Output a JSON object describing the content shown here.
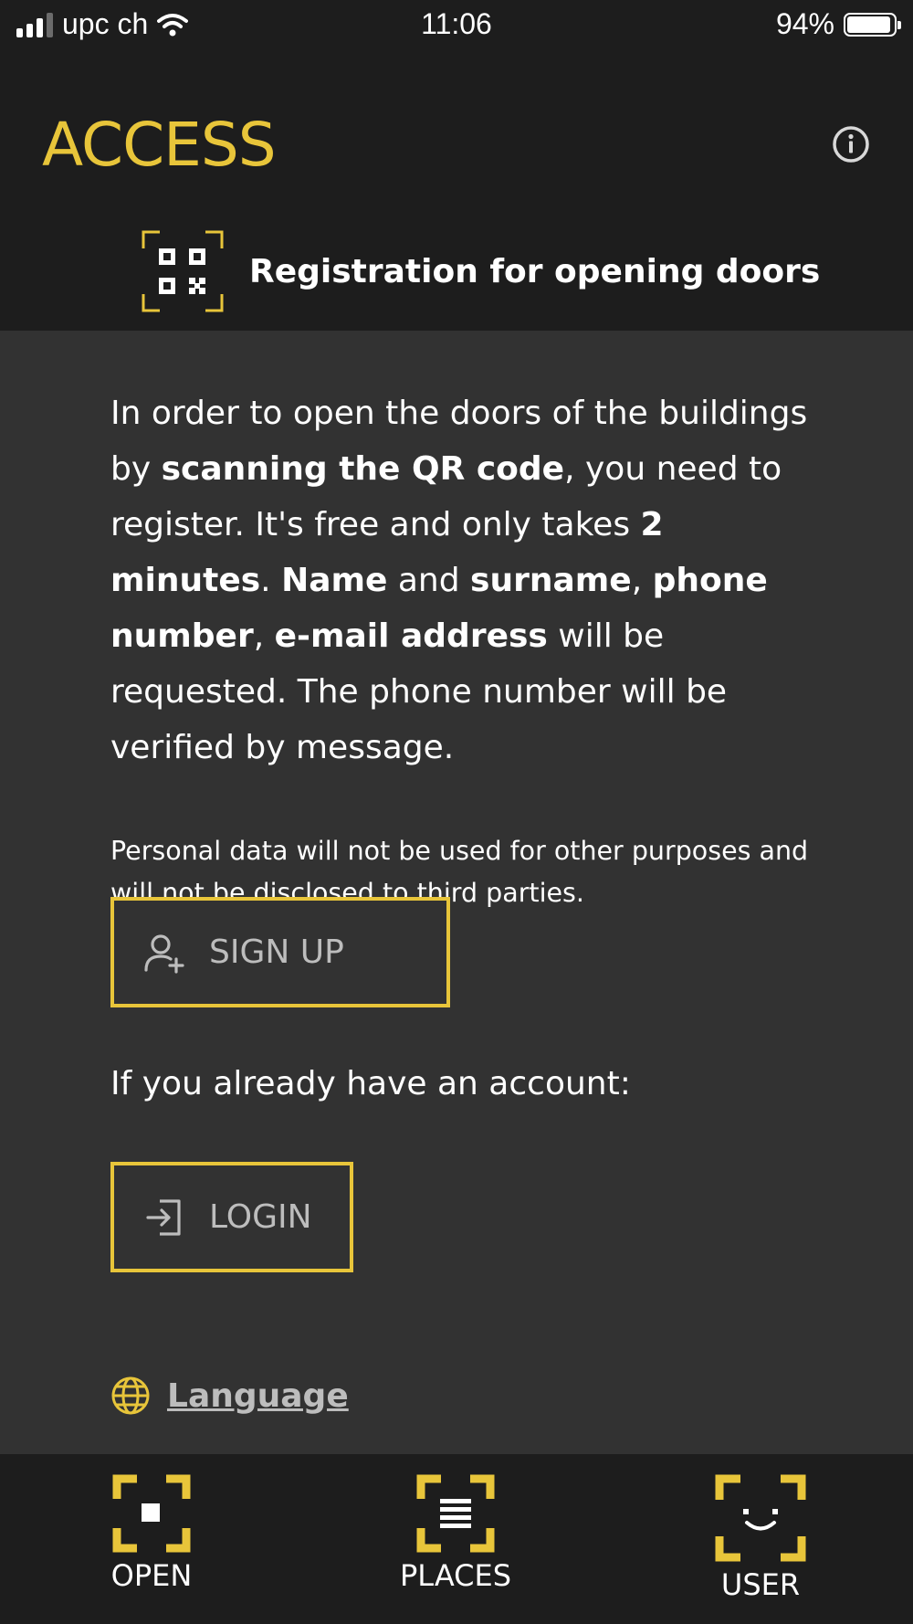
{
  "status_bar": {
    "carrier": "upc ch",
    "time": "11:06",
    "battery_percent": "94%",
    "battery_level": 0.94,
    "signal_bars": 3
  },
  "header": {
    "app_title": "ACCESS",
    "section_title": "Registration for opening doors",
    "accent_color": "#e8c53a"
  },
  "intro": {
    "segments": [
      {
        "text": "In order to open the doors of the buildings by ",
        "bold": false
      },
      {
        "text": "scanning the QR code",
        "bold": true
      },
      {
        "text": ", you need to register. It's free and only takes ",
        "bold": false
      },
      {
        "text": "2 minutes",
        "bold": true
      },
      {
        "text": ". ",
        "bold": false
      },
      {
        "text": "Name",
        "bold": true
      },
      {
        "text": " and ",
        "bold": false
      },
      {
        "text": "surname",
        "bold": true
      },
      {
        "text": ", ",
        "bold": false
      },
      {
        "text": "phone number",
        "bold": true
      },
      {
        "text": ", ",
        "bold": false
      },
      {
        "text": "e-mail address",
        "bold": true
      },
      {
        "text": " will be requested. The phone number will be verified by message.",
        "bold": false
      }
    ]
  },
  "privacy_note": "Personal data will not be used for other purposes and will not be disclosed to third parties.",
  "signup_button": {
    "label": "SIGN UP",
    "icon": "add-user-icon"
  },
  "account_prompt": "If you already have an account:",
  "login_button": {
    "label": "LOGIN",
    "icon": "login-icon"
  },
  "language_link": {
    "label": "Language",
    "icon": "globe-icon"
  },
  "tab_bar": {
    "tabs": [
      {
        "label": "OPEN",
        "icon": "open-door-scan-icon"
      },
      {
        "label": "PLACES",
        "icon": "places-list-icon"
      },
      {
        "label": "USER",
        "icon": "user-face-icon"
      }
    ]
  }
}
